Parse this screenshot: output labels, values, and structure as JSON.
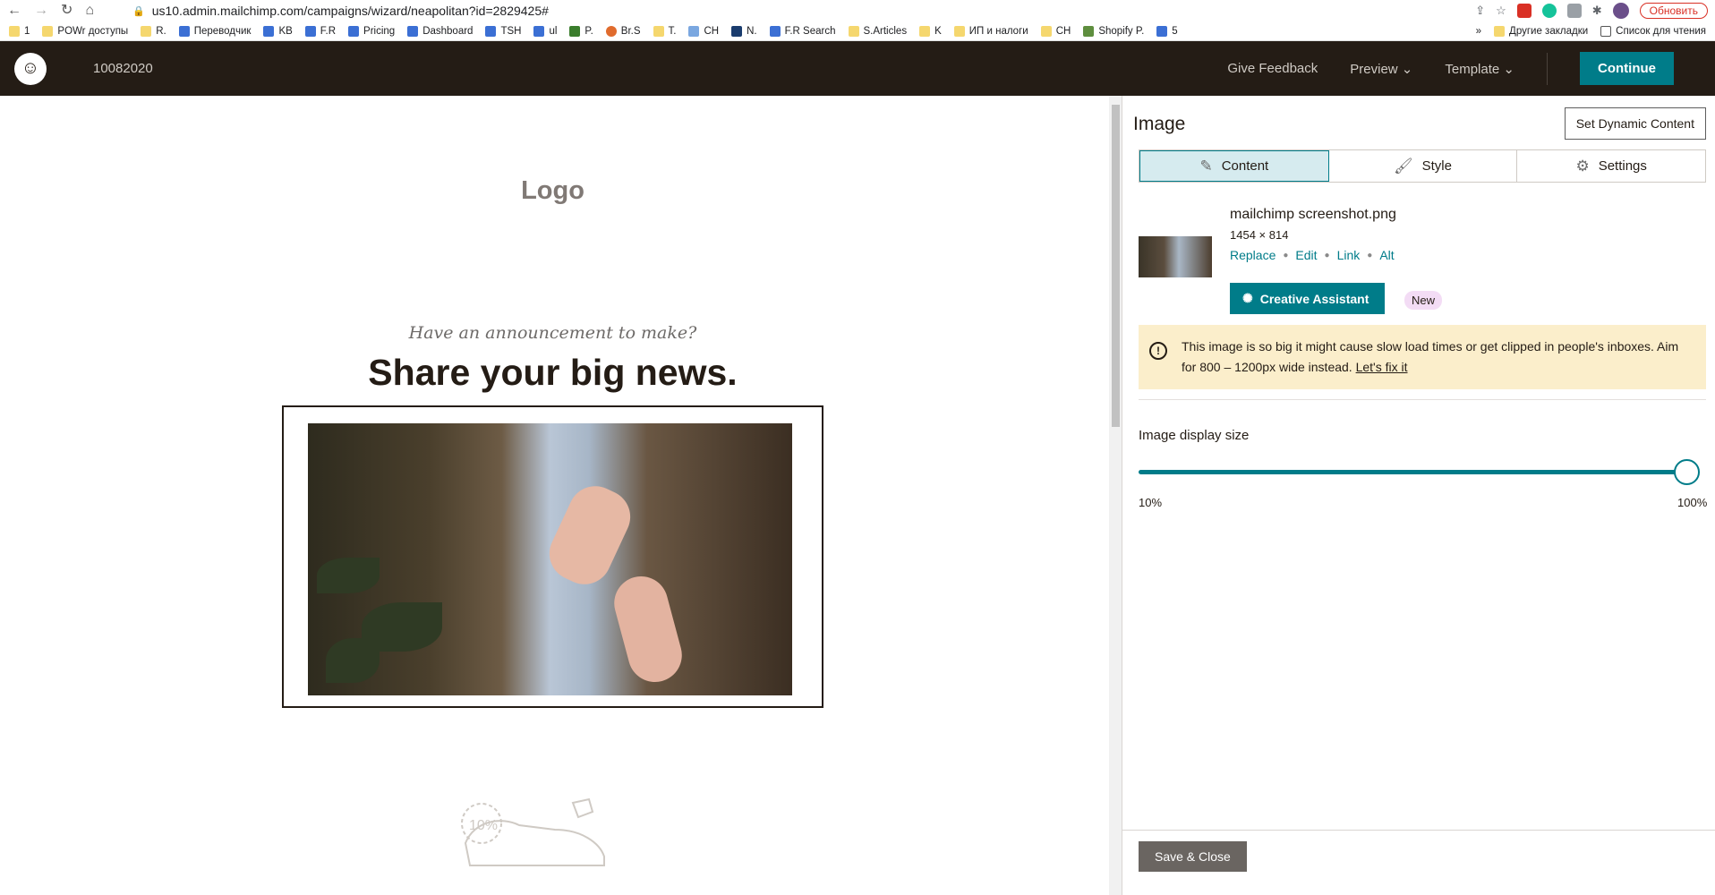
{
  "browser": {
    "url": "us10.admin.mailchimp.com/campaigns/wizard/neapolitan?id=2829425#",
    "update_label": "Обновить",
    "bookmarks": [
      "1",
      "POWr доступы",
      "R.",
      "Переводчик",
      "KB",
      "F.R",
      "Pricing",
      "Dashboard",
      "TSH",
      "ul",
      "P.",
      "Br.S",
      "T.",
      "CH",
      "N.",
      "F.R Search",
      "S.Articles",
      "K",
      "ИП и налоги",
      "CH",
      "Shopify P.",
      "5"
    ],
    "other_bookmarks": "Другие закладки",
    "reading_list": "Список для чтения"
  },
  "header": {
    "campaign_name": "10082020",
    "give_feedback": "Give Feedback",
    "preview": "Preview",
    "template": "Template",
    "continue": "Continue"
  },
  "canvas": {
    "logo_placeholder": "Logo",
    "announcement": "Have an announcement to make?",
    "headline": "Share your big news."
  },
  "panel": {
    "title": "Image",
    "dynamic_button": "Set Dynamic Content",
    "tabs": [
      "Content",
      "Style",
      "Settings"
    ],
    "file_name": "mailchimp screenshot.png",
    "dimensions": "1454 × 814",
    "links": [
      "Replace",
      "Edit",
      "Link",
      "Alt"
    ],
    "creative_assistant": "Creative Assistant",
    "new_badge": "New",
    "warning_text": "This image is so big it might cause slow load times or get clipped in people's inboxes. Aim for 800 – 1200px wide instead.",
    "warning_link": "Let's fix it",
    "size_label": "Image display size",
    "size_min": "10%",
    "size_max": "100%",
    "size_value_percent": 100,
    "save_close": "Save & Close"
  },
  "colors": {
    "accent": "#007c89",
    "header_bg": "#241c15",
    "warning_bg": "#fbeecb"
  }
}
